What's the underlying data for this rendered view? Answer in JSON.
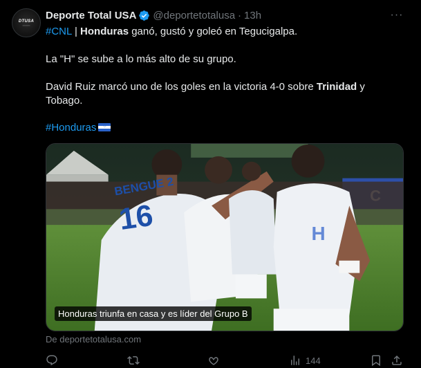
{
  "tweet": {
    "display_name": "Deporte Total USA",
    "handle": "@deportetotalusa",
    "separator": "·",
    "time": "13h",
    "more_label": "···",
    "avatar_logo": "DTUSA",
    "line1": {
      "hashtag": "#CNL",
      "sep": " | ",
      "bold": "Honduras",
      "rest": " ganó, gustó y goleó en Tegucigalpa."
    },
    "line2": "La \"H\" se sube a lo más alto de su grupo.",
    "line3": {
      "pre": "David Ruiz marcó uno de los goles en la victoria 4-0 sobre ",
      "bold": "Trinidad",
      "post": " y",
      "line_end": "Tobago."
    },
    "hashtag_line": "#Honduras",
    "media": {
      "caption": "Honduras triunfa en casa y es líder del Grupo B",
      "jersey_text": "BENGUE 2",
      "jersey_number": "16"
    },
    "source": "De deportetotalusa.com",
    "actions": {
      "views_count": "144"
    }
  },
  "colors": {
    "background": "#000000",
    "text": "#e7e9ea",
    "muted": "#71767b",
    "accent": "#1d9bf0"
  },
  "icons": [
    "verified-badge-icon",
    "more-icon",
    "reply-icon",
    "retweet-icon",
    "like-icon",
    "views-icon",
    "bookmark-icon",
    "share-icon",
    "honduras-flag-emoji"
  ]
}
